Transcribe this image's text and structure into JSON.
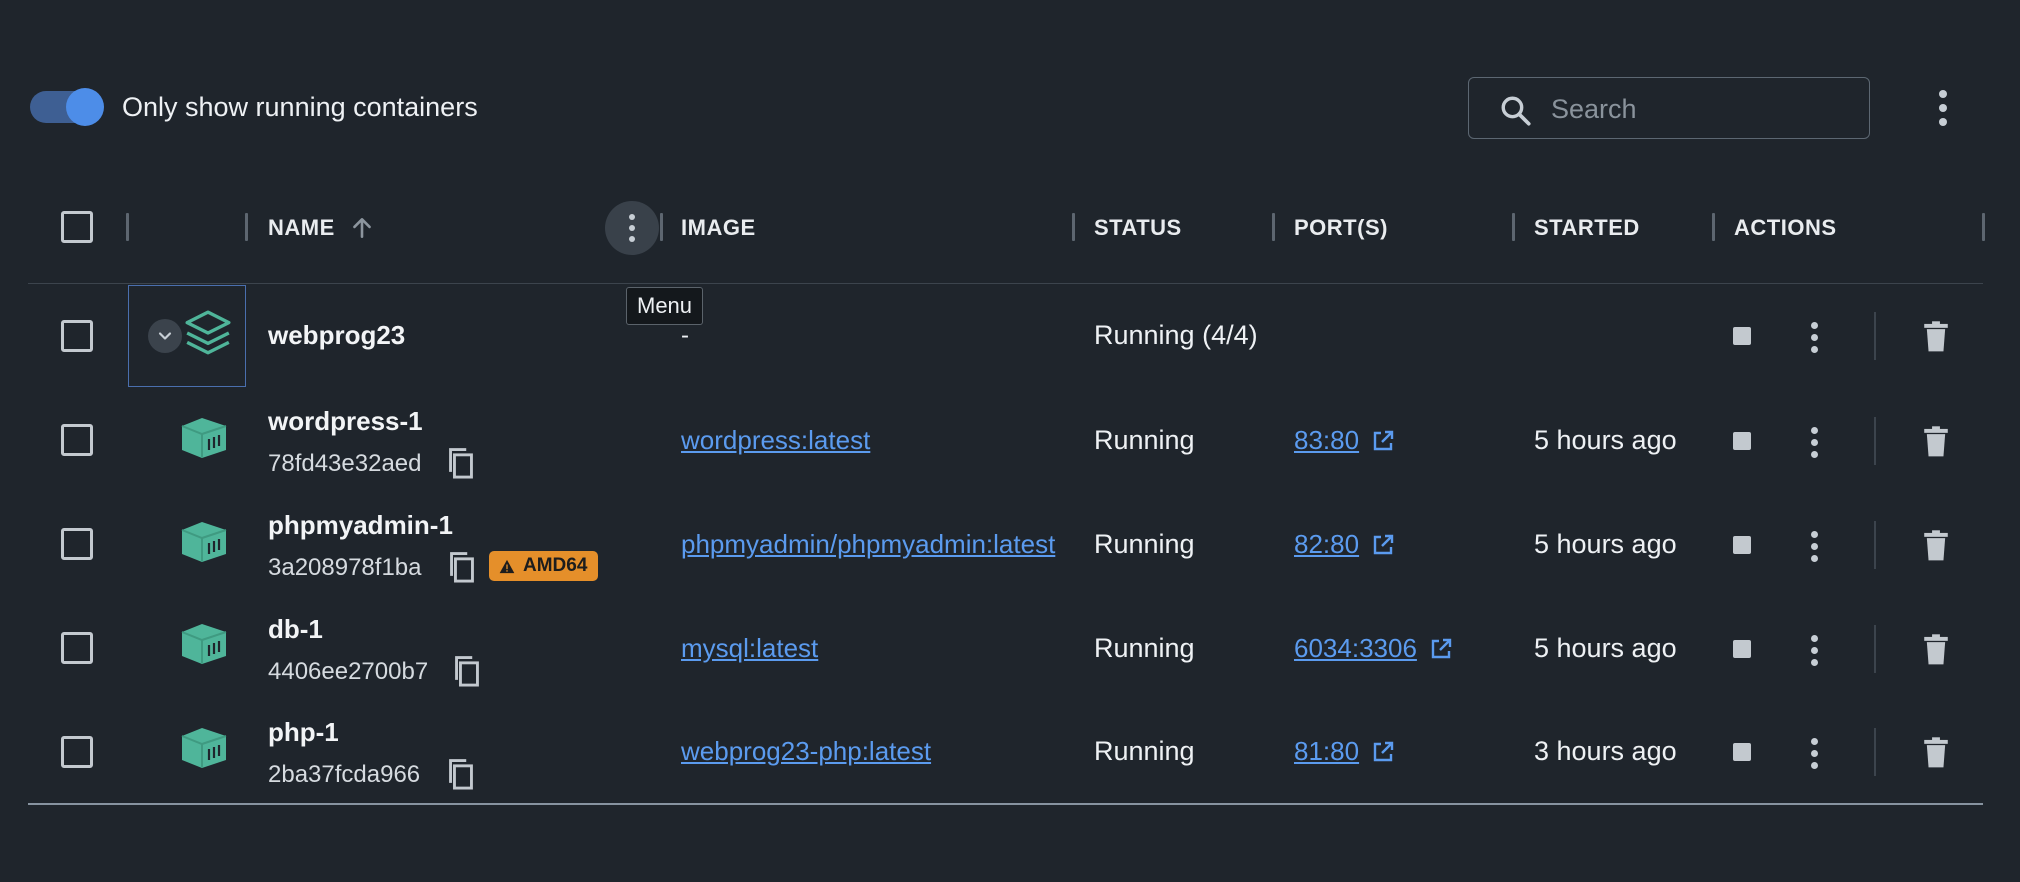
{
  "toolbar": {
    "toggle_label": "Only show running containers",
    "toggle_on": true,
    "search_placeholder": "Search"
  },
  "table": {
    "columns": [
      "NAME",
      "IMAGE",
      "STATUS",
      "PORT(S)",
      "STARTED",
      "ACTIONS"
    ],
    "sort_column": "NAME",
    "sort_direction": "ascending",
    "tooltip": "Menu",
    "group": {
      "name": "webprog23",
      "image": "-",
      "status": "Running (4/4)"
    },
    "rows": [
      {
        "name": "wordpress-1",
        "id": "78fd43e32aed",
        "image": "wordpress:latest",
        "status": "Running",
        "port": "83:80",
        "started": "5 hours ago"
      },
      {
        "name": "phpmyadmin-1",
        "id": "3a208978f1ba",
        "badge": "AMD64",
        "image": "phpmyadmin/phpmyadmin:latest",
        "status": "Running",
        "port": "82:80",
        "started": "5 hours ago"
      },
      {
        "name": "db-1",
        "id": "4406ee2700b7",
        "image": "mysql:latest",
        "status": "Running",
        "port": "6034:3306",
        "started": "5 hours ago"
      },
      {
        "name": "php-1",
        "id": "2ba37fcda966",
        "image": "webprog23-php:latest",
        "status": "Running",
        "port": "81:80",
        "started": "3 hours ago"
      }
    ]
  },
  "colors": {
    "background": "#1f252c",
    "accent": "#4d8de8",
    "link": "#5b9bef",
    "container_icon": "#4fb59a",
    "warning": "#e58f2a"
  },
  "icons": [
    "search-icon",
    "more-vert-icon",
    "arrow-up-icon",
    "chevron-down-icon",
    "stack-icon",
    "container-icon",
    "copy-icon",
    "warning-icon",
    "open-external-icon",
    "stop-icon",
    "trash-icon"
  ]
}
